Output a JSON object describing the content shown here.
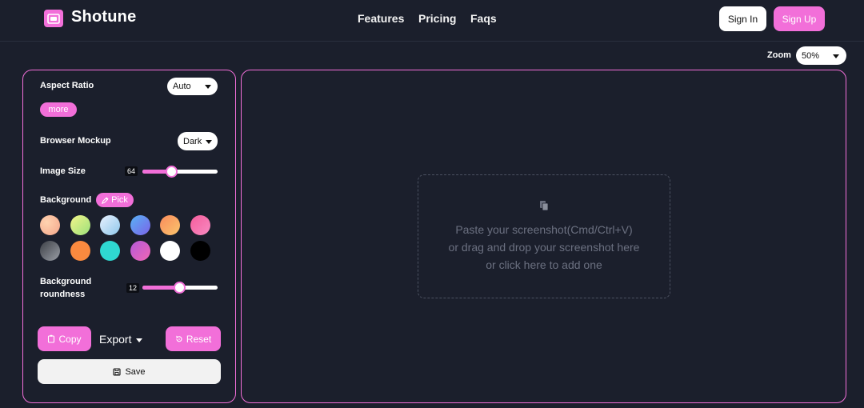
{
  "brand": {
    "name": "Shotune",
    "icon": "image-frame-icon",
    "accent": "#f26fd9"
  },
  "nav": {
    "features": "Features",
    "pricing": "Pricing",
    "faqs": "Faqs",
    "sign_in": "Sign In",
    "sign_up": "Sign Up"
  },
  "zoom": {
    "label": "Zoom",
    "value": "50%"
  },
  "controls": {
    "aspect_ratio": {
      "label": "Aspect Ratio",
      "value": "Auto",
      "more": "more"
    },
    "browser_mockup": {
      "label": "Browser Mockup",
      "value": "Dark"
    },
    "image_size": {
      "label": "Image Size",
      "value": "64"
    },
    "background": {
      "label": "Background",
      "pick": "Pick",
      "swatches": [
        "peach-gradient",
        "lime-gradient",
        "sky-gradient",
        "blue-violet-gradient",
        "orange-gradient",
        "pink-gradient",
        "gray-gradient",
        "orange-solid",
        "teal-solid",
        "purple-pink-gradient",
        "white-solid",
        "black-solid"
      ]
    },
    "background_roundness": {
      "label_line1": "Background",
      "label_line2": "roundness",
      "value": "12"
    }
  },
  "actions": {
    "copy": "Copy",
    "export": "Export",
    "reset": "Reset",
    "save": "Save"
  },
  "dropzone": {
    "line1": "Paste your screenshot(Cmd/Ctrl+V)",
    "line2": "or drag and drop your screenshot here",
    "line3": "or click here to add one",
    "icon": "clipboard-icon"
  }
}
